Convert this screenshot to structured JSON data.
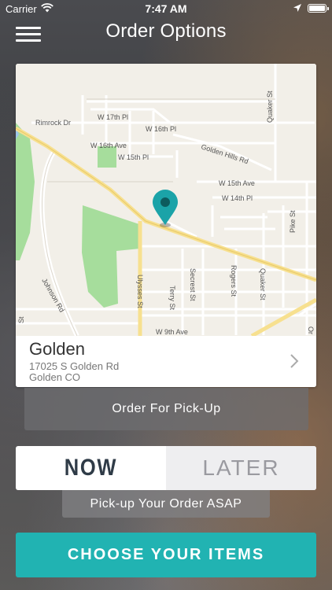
{
  "status_bar": {
    "carrier": "Carrier",
    "time": "7:47 AM",
    "icons": [
      "wifi-icon",
      "location-arrow-icon",
      "battery-icon"
    ]
  },
  "nav": {
    "title": "Order Options",
    "menu_icon": "hamburger-menu-icon"
  },
  "map": {
    "streets": {
      "rimrock": "Rimrock Dr",
      "w17th": "W 17th Pl",
      "w16thpl": "W 16th Pl",
      "w16thave": "W 16th Ave",
      "w15thpl": "W 15th Pl",
      "goldenhills": "Golden Hills Rd",
      "w15thave": "W 15th Ave",
      "w14thpl": "W 14th Pl",
      "quaker_top": "Quaker St",
      "pike": "Pike St",
      "johnson": "Johnson Rd",
      "ulysses": "Ulysses St",
      "terry": "Terry St",
      "secrest": "Secrest St",
      "rogers": "Rogers St",
      "quaker_bottom": "Quaker St",
      "w9th": "W 9th Ave",
      "left_st": "St",
      "right_or": "Or"
    },
    "pin_color": "#1ba3a8"
  },
  "location": {
    "name": "Golden",
    "address_line1": "17025 S Golden Rd",
    "address_line2": "Golden CO"
  },
  "pickup_label": "Order For Pick-Up",
  "timing": {
    "now_label": "NOW",
    "later_label": "LATER",
    "selected": "NOW",
    "description": "Pick-up Your Order ASAP"
  },
  "cta_label": "CHOOSE YOUR ITEMS",
  "colors": {
    "accent": "#21b3b2",
    "now_text": "#2f3b47",
    "later_text": "#9a9aa0"
  }
}
